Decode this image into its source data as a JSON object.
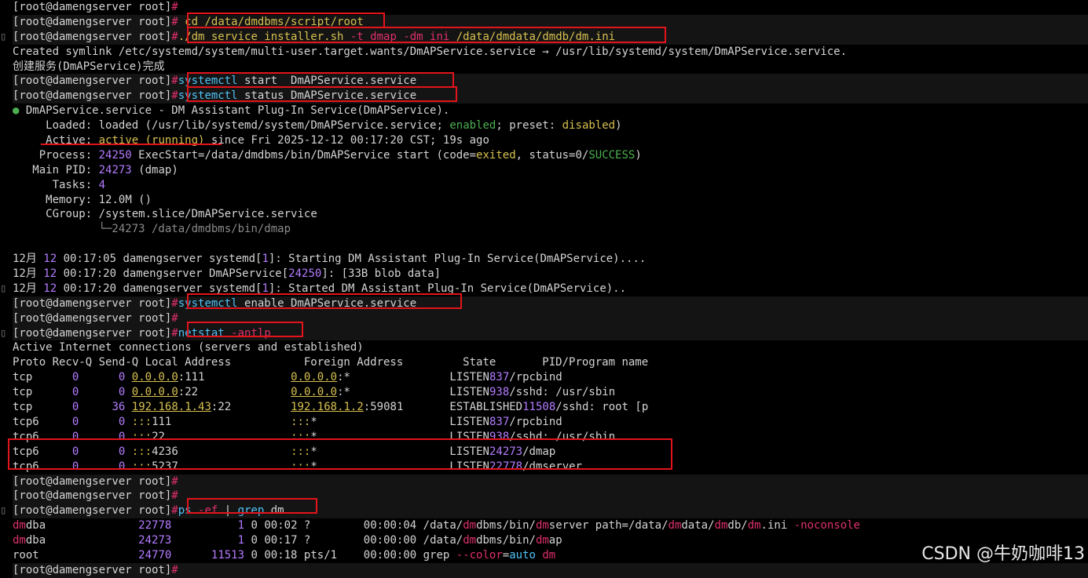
{
  "prompt": "[root@damengserver root]",
  "prompt_hash": "#",
  "cmd1": "cd /data/dmdbms/script/root",
  "cmd2": {
    "a": "./dm_service_installer.sh",
    "b": " -t dmap ",
    "c": "-dm_ini",
    "d": " /data/dmdata/dmdb/dm.ini"
  },
  "symlink_line": "Created symlink /etc/systemd/system/multi-user.target.wants/DmAPService.service → /usr/lib/systemd/system/DmAPService.service.",
  "created_line": "创建服务(DmAPService)完成",
  "cmd3": {
    "a": "systemctl",
    "b": " start  DmAPService.service"
  },
  "cmd4": {
    "a": "systemctl",
    "b": " status DmAPService.service"
  },
  "status": {
    "header": " DmAPService.service - DM Assistant Plug-In Service(DmAPService).",
    "bullet": "●",
    "loaded_label": "Loaded:",
    "loaded_value": "loaded (/usr/lib/systemd/system/DmAPService.service; ",
    "loaded_enabled": "enabled",
    "loaded_preset_label": "; preset: ",
    "loaded_preset": "disabled",
    "loaded_end": ")",
    "active_label": "Active:",
    "active_value": "active (running)",
    "active_since": " since Fri 2025-12-12 00:17:20 CST; 19s ago",
    "process_label": "Process:",
    "process_pid": "24250",
    "process_text": " ExecStart=/data/dmdbms/bin/DmAPService start (code=",
    "process_exited": "exited",
    "process_status": ", status=0/",
    "process_success": "SUCCESS",
    "process_end": ")",
    "mainpid_label": "Main PID:",
    "mainpid_value": "24273",
    "mainpid_name": " (dmap)",
    "tasks_label": "Tasks:",
    "tasks_value": "4",
    "memory_label": "Memory:",
    "memory_value": "12.0M ()",
    "cgroup_label": "CGroup:",
    "cgroup_value": "/system.slice/DmAPService.service",
    "cgroup_child": "└─24273 /data/dmdbms/bin/dmap"
  },
  "journal": [
    {
      "month": "12月",
      "day": "12",
      "rest": " 00:17:05 damengserver systemd[",
      "n": "1",
      "end": "]: Starting DM Assistant Plug-In Service(DmAPService)...."
    },
    {
      "month": "12月",
      "day": "12",
      "rest": " 00:17:20 damengserver DmAPService[",
      "n": "24250",
      "end": "]: [33B blob data]"
    },
    {
      "month": "12月",
      "day": "12",
      "rest": " 00:17:20 damengserver systemd[",
      "n": "1",
      "end": "]: Started DM Assistant Plug-In Service(DmAPService).."
    }
  ],
  "cmd5": {
    "a": "systemctl",
    "b": " enable DmAPService.service"
  },
  "cmd6": {
    "a": "netstat",
    "b": " -antlp"
  },
  "netstat_title": "Active Internet connections (servers and established)",
  "netstat_header": "Proto Recv-Q Send-Q Local Address           Foreign Address         State       PID/Program name",
  "netstat_rows": [
    {
      "proto": "tcp ",
      "recv": "0",
      "send": "0",
      "local": "0.0.0.0",
      "lport": ":111",
      "foreign": "0.0.0.0",
      "fport": ":*",
      "state": "LISTEN",
      "pid": "837",
      "prog": "/rpcbind"
    },
    {
      "proto": "tcp ",
      "recv": "0",
      "send": "0",
      "local": "0.0.0.0",
      "lport": ":22",
      "foreign": "0.0.0.0",
      "fport": ":*",
      "state": "LISTEN",
      "pid": "938",
      "prog": "/sshd: /usr/sbin"
    },
    {
      "proto": "tcp ",
      "recv": "0",
      "send": "36",
      "local": "192.168.1.43",
      "lport": ":22",
      "foreign": "192.168.1.2",
      "fport": ":59081",
      "state": "ESTABLISHED",
      "pid": "11508",
      "prog": "/sshd: root [p"
    },
    {
      "proto": "tcp6",
      "recv": "0",
      "send": "0",
      "local": ":::",
      "lport": "111",
      "foreign": ":::",
      "fport": "*",
      "state": "LISTEN",
      "pid": "837",
      "prog": "/rpcbind"
    },
    {
      "proto": "tcp6",
      "recv": "0",
      "send": "0",
      "local": ":::",
      "lport": "22",
      "foreign": ":::",
      "fport": "*",
      "state": "LISTEN",
      "pid": "938",
      "prog": "/sshd: /usr/sbin"
    },
    {
      "proto": "tcp6",
      "recv": "0",
      "send": "0",
      "local": ":::",
      "lport": "4236",
      "foreign": ":::",
      "fport": "*",
      "state": "LISTEN",
      "pid": "24273",
      "prog": "/dmap"
    },
    {
      "proto": "tcp6",
      "recv": "0",
      "send": "0",
      "local": ":::",
      "lport": "5237",
      "foreign": ":::",
      "fport": "*",
      "state": "LISTEN",
      "pid": "22778",
      "prog": "/dmserver"
    }
  ],
  "cmd7": {
    "a": "ps",
    "b": " -ef",
    "c": " | ",
    "d": "grep",
    "e": " dm"
  },
  "ps_rows": [
    {
      "user_hl": "dm",
      "user": "dba",
      "pid": "22778",
      "ppid": "1",
      "rest": " 0 00:02 ?        00:00:04 /data/",
      "path": "dm",
      "p2": "dbms/bin/",
      "p3": "dm",
      "p4": "server path=/data/",
      "p5": "dm",
      "p6": "data/",
      "p7": "dm",
      "p8": "db/",
      "p9": "dm",
      "p10": ".ini ",
      "opt": "-noconsole"
    },
    {
      "user_hl": "dm",
      "user": "dba",
      "pid": "24273",
      "ppid": "1",
      "rest": " 0 00:17 ?        00:00:00 /data/",
      "path": "dm",
      "p2": "dbms/bin/",
      "p3": "dm",
      "p4": "ap",
      "p5": "",
      "p6": "",
      "p7": "",
      "p8": "",
      "p9": "",
      "p10": "",
      "opt": ""
    },
    {
      "user_hl": "",
      "user": "root",
      "pid": "24770",
      "ppid": "11513",
      "rest": " 0 00:18 pts/1    00:00:00 grep ",
      "path": "",
      "p2": "--color",
      "p3": "",
      "p4": "=",
      "p5": "auto",
      "p6": " ",
      "p7": "dm",
      "p8": "",
      "p9": "",
      "p10": "",
      "opt": ""
    }
  ],
  "watermark": "CSDN @牛奶咖啡13"
}
